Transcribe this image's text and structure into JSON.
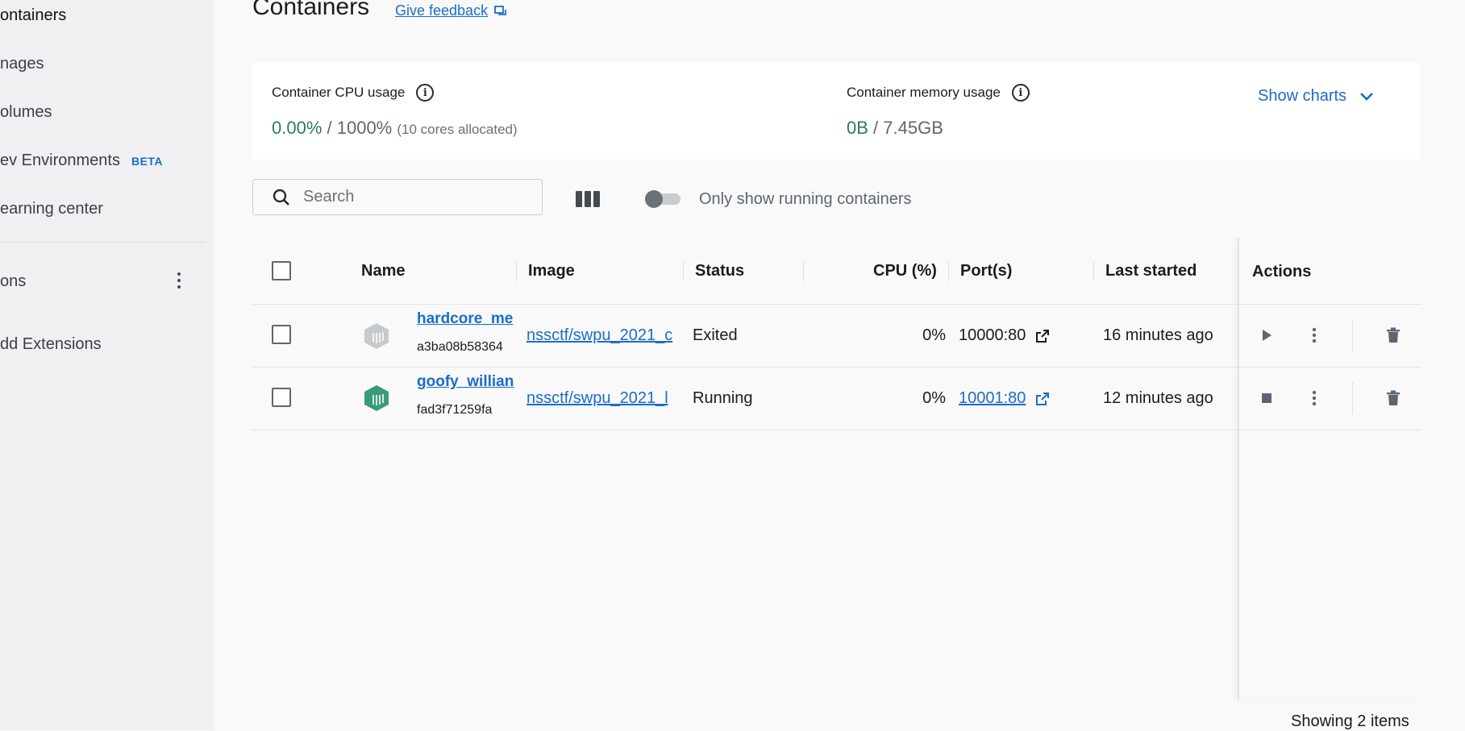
{
  "sidebar": {
    "items": [
      {
        "label": "ontainers",
        "active": true
      },
      {
        "label": "nages"
      },
      {
        "label": "olumes"
      },
      {
        "label": "ev Environments",
        "badge": "BETA"
      },
      {
        "label": "earning center"
      }
    ],
    "extensions_label": "ons",
    "add_extensions_label": "dd Extensions"
  },
  "header": {
    "title": "Containers",
    "feedback_label": "Give feedback"
  },
  "usage": {
    "cpu_label": "Container CPU usage",
    "cpu_used": "0.00%",
    "cpu_sep": " / ",
    "cpu_total": "1000%",
    "cpu_note": "(10 cores allocated)",
    "memory_label": "Container memory usage",
    "memory_used": "0B",
    "memory_sep": " / ",
    "memory_total": "7.45GB",
    "show_charts_label": "Show charts"
  },
  "toolbar": {
    "search_placeholder": "Search",
    "toggle_label": "Only show running containers",
    "toggle_on": false
  },
  "table": {
    "headers": {
      "name": "Name",
      "image": "Image",
      "status": "Status",
      "cpu": "CPU (%)",
      "ports": "Port(s)",
      "last_started": "Last started",
      "actions": "Actions"
    },
    "rows": [
      {
        "name": "hardcore_me",
        "id": "a3ba08b58364",
        "image": "nssctf/swpu_2021_c",
        "status": "Exited",
        "cpu": "0%",
        "port": "10000:80",
        "last_started": "16 minutes ago",
        "running": false
      },
      {
        "name": "goofy_willian",
        "id": "fad3f71259fa",
        "image": "nssctf/swpu_2021_l",
        "status": "Running",
        "cpu": "0%",
        "port": "10001:80",
        "last_started": "12 minutes ago",
        "running": true
      }
    ],
    "footer": "Showing 2 items"
  },
  "colors": {
    "accent": "#1a6dc9",
    "running_green": "#3a9a7c",
    "stopped_gray": "#c7cacd",
    "usage_green": "#2f7a5a"
  }
}
